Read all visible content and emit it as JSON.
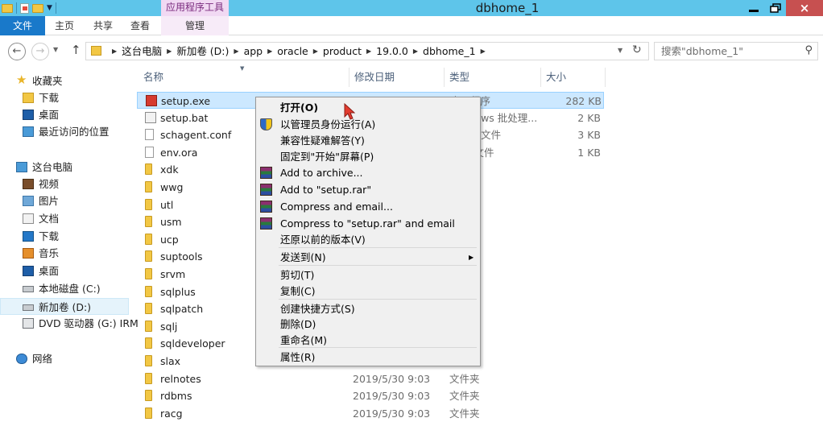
{
  "window": {
    "title": "dbhome_1",
    "context_tab_title": "应用程序工具",
    "minimize_icon": "minimize-icon",
    "restore_icon": "restore-icon",
    "close_label": "×"
  },
  "ribbon": {
    "tabs": [
      {
        "label": "文件"
      },
      {
        "label": "主页"
      },
      {
        "label": "共享"
      },
      {
        "label": "查看"
      },
      {
        "label": "管理"
      }
    ]
  },
  "address": {
    "crumbs": [
      "这台电脑",
      "新加卷 (D:)",
      "app",
      "oracle",
      "product",
      "19.0.0",
      "dbhome_1"
    ],
    "search_placeholder": "搜索\"dbhome_1\""
  },
  "nav": {
    "favorites_label": "收藏夹",
    "favorites": [
      "下载",
      "桌面",
      "最近访问的位置"
    ],
    "pc_label": "这台电脑",
    "pc_items": [
      "视频",
      "图片",
      "文档",
      "下载",
      "音乐",
      "桌面",
      "本地磁盘 (C:)",
      "新加卷 (D:)",
      "DVD 驱动器 (G:) IRM"
    ],
    "network_label": "网络"
  },
  "columns": {
    "name": "名称",
    "date": "修改日期",
    "type": "类型",
    "size": "大小"
  },
  "files": [
    {
      "name": "setup.exe",
      "date": "",
      "type": "应用程序",
      "size": "282 KB",
      "icon": "exe"
    },
    {
      "name": "setup.bat",
      "date": "",
      "type": "Windows 批处理...",
      "size": "2 KB",
      "icon": "bat"
    },
    {
      "name": "schagent.conf",
      "date": "",
      "type": "CONF 文件",
      "size": "3 KB",
      "icon": "txt"
    },
    {
      "name": "env.ora",
      "date": "",
      "type": "ORA 文件",
      "size": "1 KB",
      "icon": "txt"
    },
    {
      "name": "xdk",
      "date": "",
      "type": "",
      "size": "",
      "icon": "folder"
    },
    {
      "name": "wwg",
      "date": "",
      "type": "",
      "size": "",
      "icon": "folder"
    },
    {
      "name": "utl",
      "date": "",
      "type": "",
      "size": "",
      "icon": "folder"
    },
    {
      "name": "usm",
      "date": "",
      "type": "",
      "size": "",
      "icon": "folder"
    },
    {
      "name": "ucp",
      "date": "",
      "type": "",
      "size": "",
      "icon": "folder"
    },
    {
      "name": "suptools",
      "date": "",
      "type": "",
      "size": "",
      "icon": "folder"
    },
    {
      "name": "srvm",
      "date": "",
      "type": "",
      "size": "",
      "icon": "folder"
    },
    {
      "name": "sqlplus",
      "date": "",
      "type": "",
      "size": "",
      "icon": "folder"
    },
    {
      "name": "sqlpatch",
      "date": "",
      "type": "",
      "size": "",
      "icon": "folder"
    },
    {
      "name": "sqlj",
      "date": "",
      "type": "",
      "size": "",
      "icon": "folder"
    },
    {
      "name": "sqldeveloper",
      "date": "",
      "type": "",
      "size": "",
      "icon": "folder"
    },
    {
      "name": "slax",
      "date": "",
      "type": "",
      "size": "",
      "icon": "folder"
    },
    {
      "name": "relnotes",
      "date": "2019/5/30 9:03",
      "type": "文件夹",
      "size": "",
      "icon": "folder"
    },
    {
      "name": "rdbms",
      "date": "2019/5/30 9:03",
      "type": "文件夹",
      "size": "",
      "icon": "folder"
    },
    {
      "name": "racg",
      "date": "2019/5/30 9:03",
      "type": "文件夹",
      "size": "",
      "icon": "folder"
    }
  ],
  "context_menu": [
    {
      "label": "打开(O)",
      "bold": true
    },
    {
      "label": "以管理员身份运行(A)",
      "icon": "shield"
    },
    {
      "label": "兼容性疑难解答(Y)"
    },
    {
      "label": "固定到\"开始\"屏幕(P)"
    },
    {
      "label": "Add to archive...",
      "icon": "rar"
    },
    {
      "label": "Add to \"setup.rar\"",
      "icon": "rar"
    },
    {
      "label": "Compress and email...",
      "icon": "rar"
    },
    {
      "label": "Compress to \"setup.rar\" and email",
      "icon": "rar"
    },
    {
      "label": "还原以前的版本(V)"
    },
    {
      "label": "发送到(N)",
      "submenu": true
    },
    {
      "label": "剪切(T)"
    },
    {
      "label": "复制(C)"
    },
    {
      "label": "创建快捷方式(S)"
    },
    {
      "label": "删除(D)"
    },
    {
      "label": "重命名(M)"
    },
    {
      "label": "属性(R)"
    }
  ]
}
